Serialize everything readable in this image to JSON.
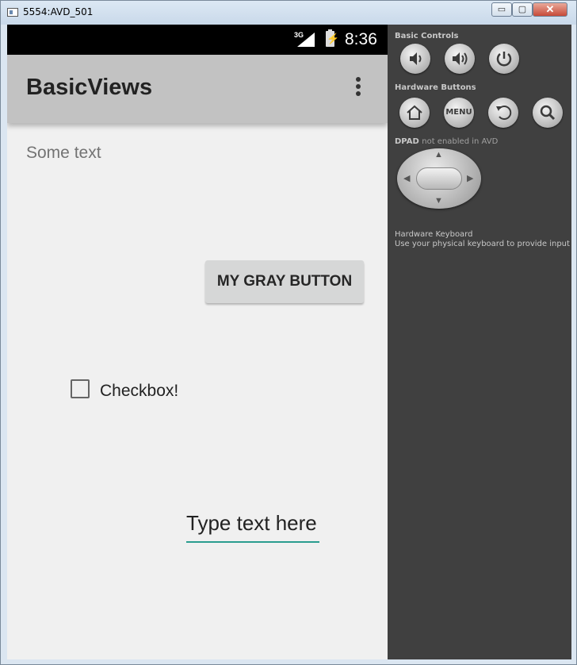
{
  "window": {
    "title": "5554:AVD_501",
    "controls": {
      "minimize": "▭",
      "maximize": "▢",
      "close": "✕"
    }
  },
  "status_bar": {
    "network": "3G",
    "time": "8:36",
    "icons": [
      "signal-icon",
      "battery-icon"
    ]
  },
  "app_bar": {
    "title": "BasicViews",
    "overflow_icon": "overflow-menu-icon"
  },
  "content": {
    "some_text": "Some text",
    "gray_button_label": "MY GRAY BUTTON",
    "checkbox_label": "Checkbox!",
    "checkbox_checked": false,
    "text_field_placeholder": "Type text here",
    "accent_color": "#2a9d8f"
  },
  "controls_panel": {
    "basic_controls_label": "Basic Controls",
    "basic_controls": [
      "volume-down-icon",
      "volume-up-icon",
      "power-icon"
    ],
    "hardware_buttons_label": "Hardware Buttons",
    "hardware_buttons": [
      "home-icon",
      "menu-button",
      "back-icon",
      "search-icon"
    ],
    "menu_label": "MENU",
    "dpad_label": "DPAD",
    "dpad_note": "not enabled in AVD",
    "keyboard_label": "Hardware Keyboard",
    "keyboard_note": "Use your physical keyboard to provide input"
  }
}
